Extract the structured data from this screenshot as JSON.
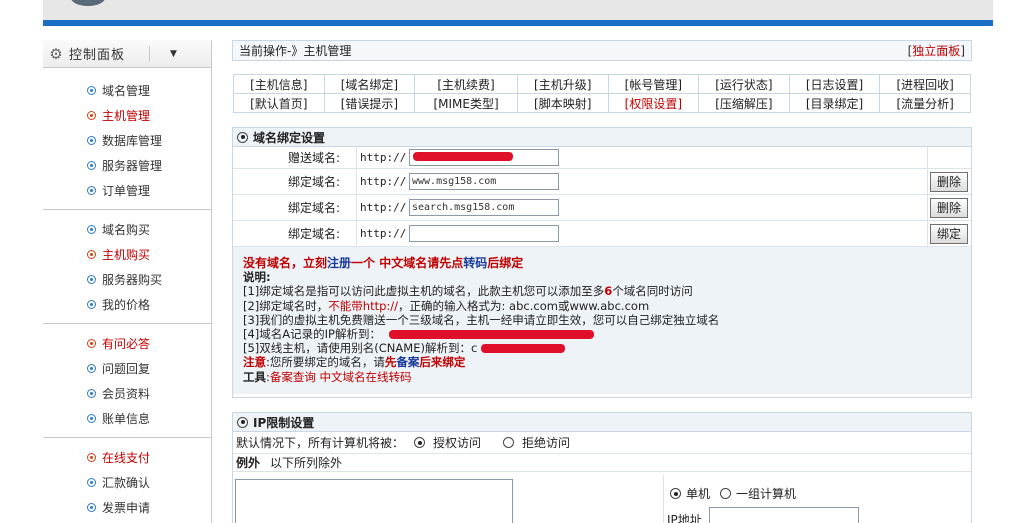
{
  "sidebar": {
    "title": "控制面板",
    "groups": [
      {
        "items": [
          {
            "label": "域名管理"
          },
          {
            "label": "主机管理"
          },
          {
            "label": "数据库管理"
          },
          {
            "label": "服务器管理"
          },
          {
            "label": "订单管理"
          }
        ]
      },
      {
        "items": [
          {
            "label": "域名购买"
          },
          {
            "label": "主机购买"
          },
          {
            "label": "服务器购买"
          },
          {
            "label": "我的价格"
          }
        ]
      },
      {
        "items": [
          {
            "label": "有问必答"
          },
          {
            "label": "问题回复"
          },
          {
            "label": "会员资料"
          },
          {
            "label": "账单信息"
          }
        ]
      },
      {
        "items": [
          {
            "label": "在线支付"
          },
          {
            "label": "汇款确认"
          },
          {
            "label": "发票申请"
          }
        ]
      }
    ]
  },
  "breadcrumb": {
    "text": "当前操作-》主机管理",
    "panel_link": "独立面板"
  },
  "tabs": {
    "row1": [
      "[主机信息]",
      "[域名绑定]",
      "[主机续费]",
      "[主机升级]",
      "[帐号管理]",
      "[运行状态]",
      "[日志设置]",
      "[进程回收]"
    ],
    "row2": [
      "[默认首页]",
      "[错误提示]",
      "[MIME类型]",
      "[脚本映射]",
      "[权限设置]",
      "[压缩解压]",
      "[目录绑定]",
      "[流量分析]"
    ]
  },
  "domain_section": {
    "title": "域名绑定设置",
    "rows": [
      {
        "label": "赠送域名:",
        "prefix": "http://",
        "value": "",
        "button": ""
      },
      {
        "label": "绑定域名:",
        "prefix": "http://",
        "value": "www.msg158.com",
        "button": "删除"
      },
      {
        "label": "绑定域名:",
        "prefix": "http://",
        "value": "search.msg158.com",
        "button": "删除"
      },
      {
        "label": "绑定域名:",
        "prefix": "http://",
        "value": "",
        "button": "绑定"
      }
    ],
    "notes": {
      "headline_a": "没有域名，立刻",
      "headline_link": "注册",
      "headline_b": "一个  中文域名请先点",
      "headline_link2": "转码",
      "headline_c": "后绑定",
      "desc_label": "说明:",
      "line1_a": "[1]绑定域名是指可以访问此虚拟主机的域名，此款主机您可以添加至多",
      "line1_num": "6",
      "line1_b": "个域名同时访问",
      "line2_a": "[2]绑定域名时，",
      "line2_red": "不能带http://",
      "line2_b": "，正确的输入格式为: abc.com或www.abc.com",
      "line3": "[3]我们的虚拟主机免费赠送一个三级域名，主机一经申请立即生效，您可以自己绑定独立域名",
      "line4": "[4]域名A记录的IP解析到：",
      "line5": "[5]双线主机，请使用别名(CNAME)解析到：c",
      "attention_label": "注意",
      "attention_a": ":您所要绑定的域名，请",
      "attention_b": "先",
      "attention_c": "备案",
      "attention_d": "后来绑定",
      "tools_label": "工具",
      "tools_a": ":",
      "tools_link1": "备案查询",
      "tools_link2": "中文域名在线转码"
    }
  },
  "ip_section": {
    "title": "IP限制设置",
    "default_text": "默认情况下，所有计算机将被：",
    "allow": "授权访问",
    "deny": "拒绝访问",
    "except_label": "例外",
    "except_text": "以下所列除外",
    "single": "单机",
    "group": "一组计算机",
    "ip_label": "IP地址"
  },
  "colors": {
    "accent_blue": "#1a6fc4",
    "alert_red": "#c00000",
    "border": "#c9d6e4"
  }
}
